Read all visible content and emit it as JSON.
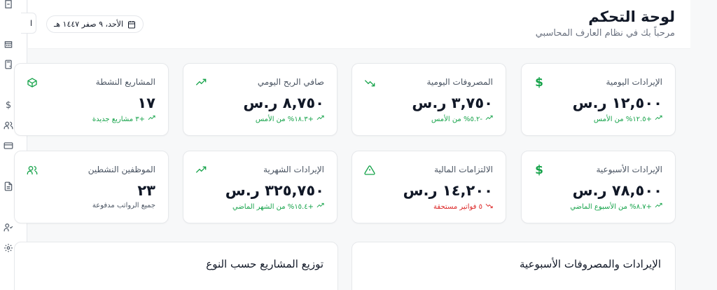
{
  "header": {
    "title": "لوحة التحكم",
    "subtitle": "مرحباً بك في نظام العارف المحاسبي",
    "date": "الأحد، ٩ صفر ١٤٤٧ هـ",
    "cut_button_label": "ا"
  },
  "sidebar": {
    "icons": [
      "building-icon",
      "building-icon",
      "calculator-icon",
      "dollar-icon",
      "users-icon",
      "credit-card-icon",
      "file-text-icon",
      "user-check-icon",
      "settings-icon"
    ]
  },
  "cards": [
    {
      "label": "الإيرادات اليومية",
      "value": "١٢,٥٠٠ ر.س",
      "delta": "+١٢.٥% من الأمس",
      "trend": "up",
      "icon": "dollar-icon"
    },
    {
      "label": "المصروفات اليومية",
      "value": "٣,٧٥٠ ر.س",
      "delta": "-٥.٢% من الأمس",
      "trend": "up",
      "icon": "trending-down-icon"
    },
    {
      "label": "صافي الربح اليومي",
      "value": "٨,٧٥٠ ر.س",
      "delta": "+١٨.٣% من الأمس",
      "trend": "up",
      "icon": "trending-up-icon"
    },
    {
      "label": "المشاريع النشطة",
      "value": "١٧",
      "delta": "+٣ مشاريع جديدة",
      "trend": "up",
      "icon": "package-icon"
    },
    {
      "label": "الإيرادات الأسبوعية",
      "value": "٧٨,٥٠٠ ر.س",
      "delta": "+٨.٧% من الأسبوع الماضي",
      "trend": "up",
      "icon": "dollar-icon"
    },
    {
      "label": "الالتزامات المالية",
      "value": "١٤,٢٠٠ ر.س",
      "delta": "٥ فواتير مستحقة",
      "trend": "down",
      "icon": "alert-triangle-icon"
    },
    {
      "label": "الإيرادات الشهرية",
      "value": "٣٢٥,٧٥٠ ر.س",
      "delta": "+١٥.٤% من الشهر الماضي",
      "trend": "up",
      "icon": "trending-up-icon"
    },
    {
      "label": "الموظفين النشطين",
      "value": "٢٣",
      "delta": "جميع الرواتب مدفوعة",
      "trend": "none",
      "icon": "users-icon"
    }
  ],
  "panels": {
    "weekly": "الإيرادات والمصروفات الأسبوعية",
    "projects": "توزيع المشاريع حسب النوع"
  },
  "colors": {
    "accent_green": "#16a34a",
    "accent_red": "#dc2626",
    "card_border": "#e6e8eb",
    "background": "#f7f8f9"
  }
}
